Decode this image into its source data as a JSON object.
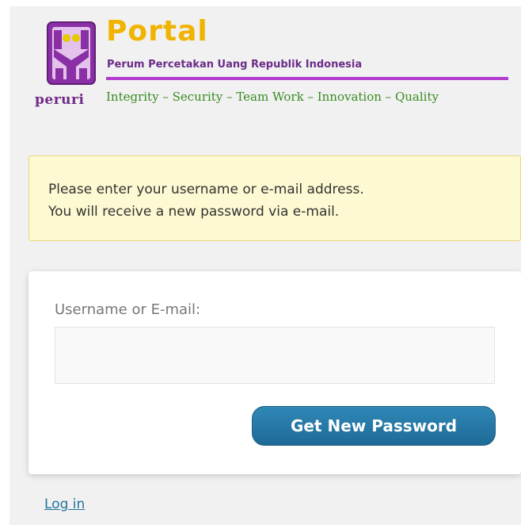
{
  "logo": {
    "wordmark": "peruri",
    "title": "Portal",
    "subtitle": "Perum Percetakan Uang Republik Indonesia",
    "values": "Integrity – Security – Team Work – Innovation – Quality",
    "colors": {
      "mark": "#8b2fa6",
      "mark_accent": "#e8c800",
      "title": "#f0b400",
      "values": "#3a8a22",
      "rule": "#b23ecf"
    }
  },
  "message": {
    "line1": "Please enter your username or e-mail address.",
    "line2": "You will receive a new password via e-mail."
  },
  "form": {
    "username_label": "Username or E-mail:",
    "username_value": "",
    "submit_label": "Get New Password"
  },
  "nav": {
    "login_label": "Log in"
  }
}
